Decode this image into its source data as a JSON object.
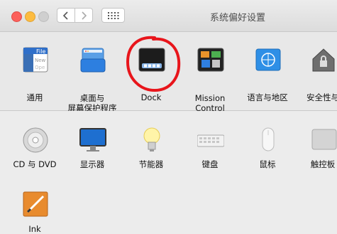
{
  "window": {
    "title": "系统偏好设置"
  },
  "row1": [
    {
      "label1": "通用",
      "label2": ""
    },
    {
      "label1": "桌面与",
      "label2": "屏幕保护程序"
    },
    {
      "label1": "Dock",
      "label2": ""
    },
    {
      "label1": "Mission",
      "label2": "Control"
    },
    {
      "label1": "语言与地区",
      "label2": ""
    },
    {
      "label1": "安全性与",
      "label2": ""
    }
  ],
  "row2": [
    {
      "label1": "CD 与 DVD"
    },
    {
      "label1": "显示器"
    },
    {
      "label1": "节能器"
    },
    {
      "label1": "键盘"
    },
    {
      "label1": "鼠标"
    },
    {
      "label1": "触控板"
    }
  ],
  "row3": [
    {
      "label1": "Ink"
    }
  ],
  "icons": {
    "general_text": "File\nNew\nOpe"
  },
  "colors": {
    "annotation": "#e8151b",
    "accent": "#1f7ddb"
  }
}
